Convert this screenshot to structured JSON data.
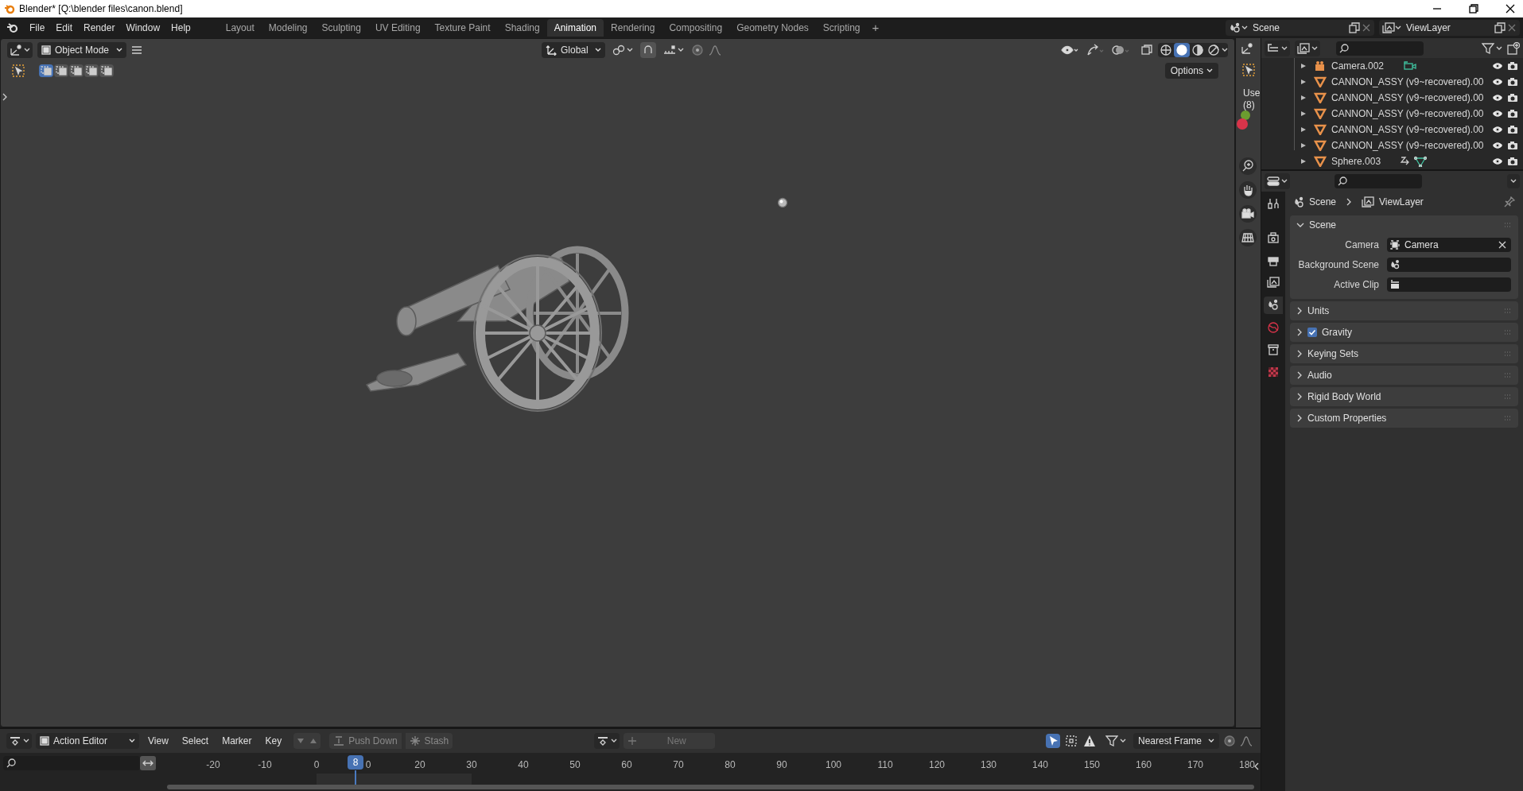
{
  "window": {
    "title": "Blender* [Q:\\blender files\\canon.blend]"
  },
  "menu": [
    "File",
    "Edit",
    "Render",
    "Window",
    "Help"
  ],
  "workspaces": [
    {
      "label": "Layout",
      "selected": false
    },
    {
      "label": "Modeling",
      "selected": false
    },
    {
      "label": "Sculpting",
      "selected": false
    },
    {
      "label": "UV Editing",
      "selected": false
    },
    {
      "label": "Texture Paint",
      "selected": false
    },
    {
      "label": "Shading",
      "selected": false
    },
    {
      "label": "Animation",
      "selected": true
    },
    {
      "label": "Rendering",
      "selected": false
    },
    {
      "label": "Compositing",
      "selected": false
    },
    {
      "label": "Geometry Nodes",
      "selected": false
    },
    {
      "label": "Scripting",
      "selected": false
    }
  ],
  "add_workspace": "+",
  "scene": "Scene",
  "view_layer": "ViewLayer",
  "viewport": {
    "mode": "Object Mode",
    "orientation": "Global",
    "options": "Options",
    "select_modes": [
      {
        "selected": true
      },
      {
        "selected": false
      },
      {
        "selected": false
      },
      {
        "selected": false
      },
      {
        "selected": false
      }
    ],
    "shading": [
      {
        "kind": "wireframe",
        "selected": false
      },
      {
        "kind": "solid",
        "selected": true
      },
      {
        "kind": "material",
        "selected": false
      },
      {
        "kind": "rendered",
        "selected": false
      }
    ]
  },
  "side_viewport": {
    "lines": [
      "Use",
      "(8)"
    ]
  },
  "outliner": {
    "rows": [
      {
        "name": "Camera.002",
        "kind": "camera"
      },
      {
        "name": "CANNON_ASSY (v9~recovered).00",
        "kind": "mesh"
      },
      {
        "name": "CANNON_ASSY (v9~recovered).00",
        "kind": "mesh"
      },
      {
        "name": "CANNON_ASSY (v9~recovered).00",
        "kind": "mesh"
      },
      {
        "name": "CANNON_ASSY (v9~recovered).00",
        "kind": "mesh"
      },
      {
        "name": "CANNON_ASSY (v9~recovered).00",
        "kind": "mesh"
      },
      {
        "name": "Sphere.003",
        "kind": "mesh_with_data"
      }
    ]
  },
  "properties": {
    "tabs": [
      {
        "kind": "tool",
        "selected": false
      },
      {
        "kind": "render",
        "selected": false
      },
      {
        "kind": "output",
        "selected": false
      },
      {
        "kind": "view_layer",
        "selected": false
      },
      {
        "kind": "scene",
        "selected": true
      },
      {
        "kind": "world",
        "selected": false
      },
      {
        "kind": "collection",
        "selected": false
      },
      {
        "kind": "texture",
        "selected": false
      }
    ],
    "breadcrumb": [
      "Scene",
      "ViewLayer"
    ],
    "panels": [
      {
        "title": "Scene",
        "kind": "plain",
        "expanded": true,
        "fields": [
          {
            "label": "Camera",
            "kind": "object",
            "value": "Camera"
          },
          {
            "label": "Background Scene",
            "kind": "scene"
          },
          {
            "label": "Active Clip",
            "kind": "clip"
          }
        ]
      },
      {
        "title": "Units",
        "kind": "plain",
        "expanded": false
      },
      {
        "title": "Gravity",
        "kind": "checkbox",
        "checked": true,
        "expanded": false
      },
      {
        "title": "Keying Sets",
        "kind": "plain",
        "expanded": false
      },
      {
        "title": "Audio",
        "kind": "plain",
        "expanded": false
      },
      {
        "title": "Rigid Body World",
        "kind": "plain",
        "expanded": false
      },
      {
        "title": "Custom Properties",
        "kind": "plain",
        "expanded": false
      }
    ]
  },
  "action_editor": {
    "editor": "Action Editor",
    "menu": [
      "View",
      "Select",
      "Marker",
      "Key"
    ],
    "push_down": "Push Down",
    "stash": "Stash",
    "new": "New",
    "snap": "Nearest Frame",
    "ticks": [
      "-20",
      "-10",
      "0",
      "0",
      "20",
      "30",
      "40",
      "50",
      "60",
      "70",
      "80",
      "90",
      "100",
      "110",
      "120",
      "130",
      "140",
      "150",
      "160",
      "170",
      "180"
    ],
    "current_frame": "8"
  }
}
